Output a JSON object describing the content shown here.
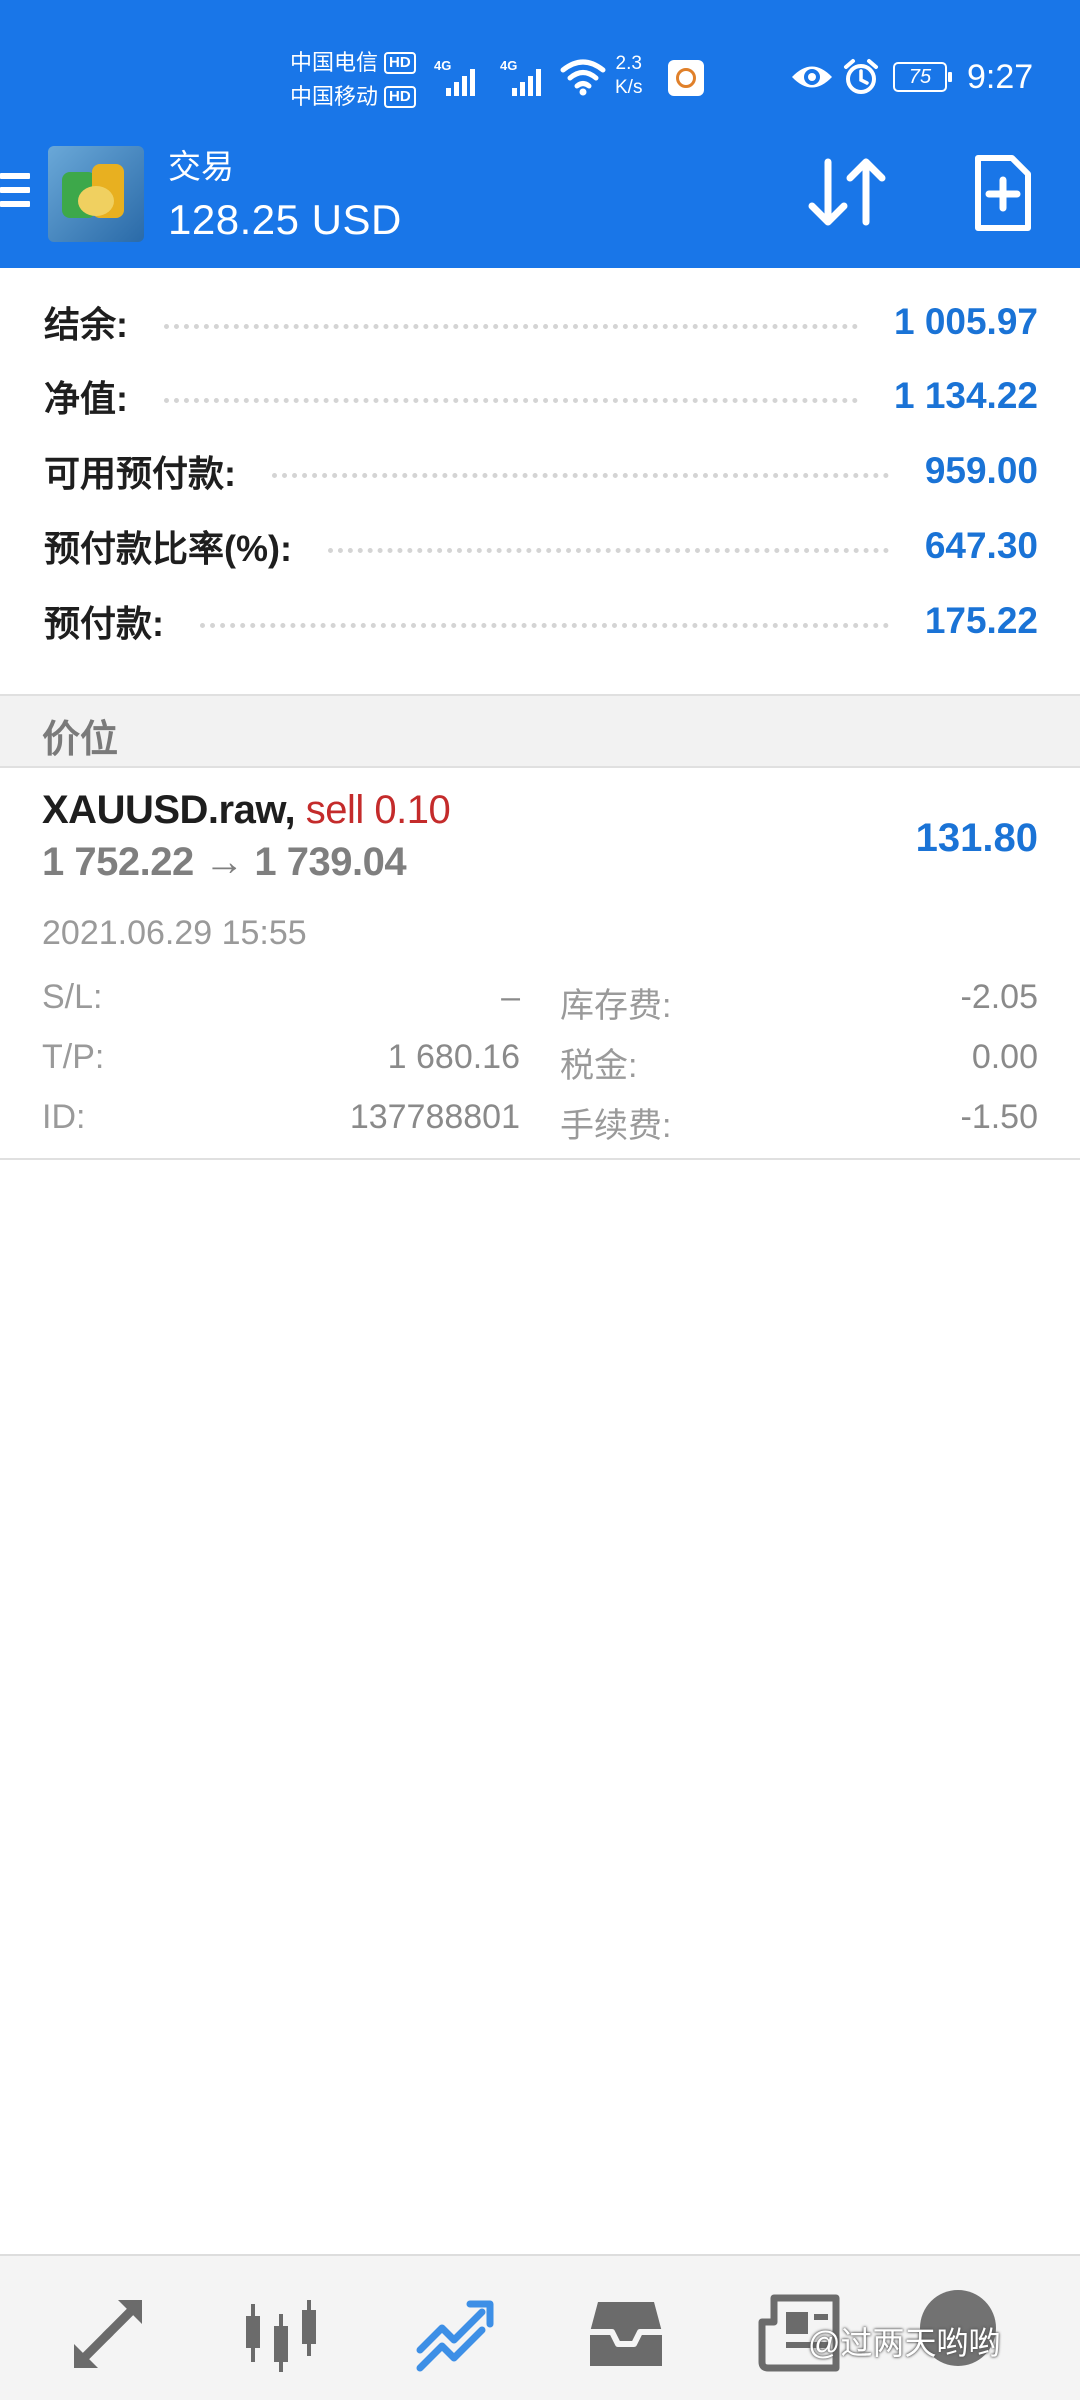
{
  "status_bar": {
    "carrier1": "中国电信",
    "carrier2": "中国移动",
    "hd_label": "HD",
    "net_type": "4G",
    "speed_value": "2.3",
    "speed_unit": "K/s",
    "battery": "75",
    "time": "9:27"
  },
  "app_bar": {
    "title": "交易",
    "balance_display": "128.25 USD",
    "icons": [
      "menu-icon",
      "sort-icon",
      "new-order-icon"
    ]
  },
  "summary": [
    {
      "label": "结余:",
      "value": "1 005.97"
    },
    {
      "label": "净值:",
      "value": "1 134.22"
    },
    {
      "label": "可用预付款:",
      "value": "959.00"
    },
    {
      "label": "预付款比率(%):",
      "value": "647.30"
    },
    {
      "label": "预付款:",
      "value": "175.22"
    }
  ],
  "section_title": "价位",
  "position": {
    "symbol": "XAUUSD.raw,",
    "side": "sell 0.10",
    "prices": "1 752.22 → 1 739.04",
    "profit": "131.80",
    "time": "2021.06.29 15:55",
    "sl_label": "S/L:",
    "sl_value": "–",
    "tp_label": "T/P:",
    "tp_value": "1 680.16",
    "id_label": "ID:",
    "id_value": "137788801",
    "swap_label": "库存费:",
    "swap_value": "-2.05",
    "tax_label": "税金:",
    "tax_value": "0.00",
    "commission_label": "手续费:",
    "commission_value": "-1.50"
  },
  "bottom_nav": {
    "items": [
      "quotes-icon",
      "chart-icon",
      "trade-icon",
      "history-icon",
      "news-icon"
    ],
    "active": "trade-icon"
  },
  "watermark": "@过两天哟哟",
  "colors": {
    "header": "#1976e8",
    "value_blue": "#1a73d6",
    "sell_red": "#c42b2b",
    "active_nav": "#3d8fe6",
    "inactive_nav": "#6b6b6b"
  }
}
